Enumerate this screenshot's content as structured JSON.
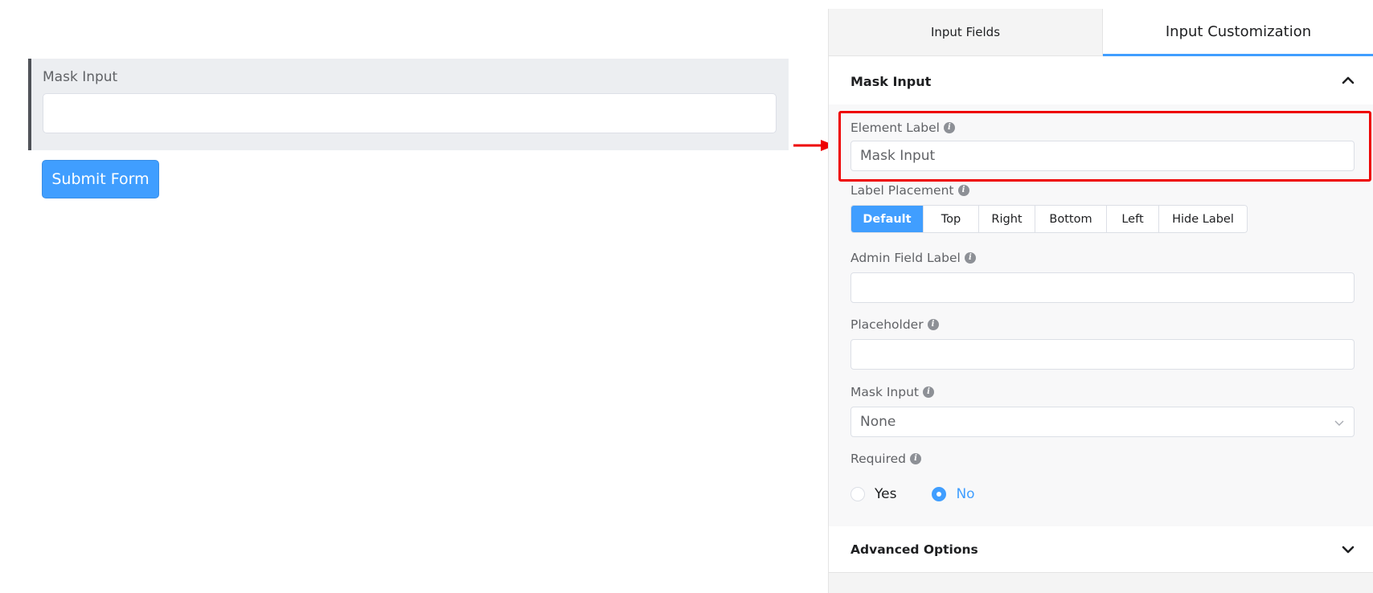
{
  "canvas": {
    "field_label": "Mask Input",
    "submit_label": "Submit Form"
  },
  "tabs": [
    {
      "label": "Input Fields",
      "active": false
    },
    {
      "label": "Input Customization",
      "active": true
    }
  ],
  "section": {
    "title": "Mask Input",
    "element_label": {
      "label": "Element Label",
      "value": "Mask Input"
    },
    "label_placement": {
      "label": "Label Placement",
      "options": [
        "Default",
        "Top",
        "Right",
        "Bottom",
        "Left",
        "Hide Label"
      ],
      "selected": "Default"
    },
    "admin_field_label": {
      "label": "Admin Field Label",
      "value": ""
    },
    "placeholder": {
      "label": "Placeholder",
      "value": ""
    },
    "mask_input": {
      "label": "Mask Input",
      "value": "None"
    },
    "required": {
      "label": "Required",
      "options": [
        "Yes",
        "No"
      ],
      "selected": "No"
    }
  },
  "advanced": {
    "title": "Advanced Options"
  },
  "colors": {
    "accent": "#409eff",
    "highlight": "#ee0000"
  },
  "icons": {
    "info": "info-icon",
    "collapse": "chevron-up-icon",
    "expand": "chevron-down-icon",
    "select": "chevron-down-icon"
  }
}
